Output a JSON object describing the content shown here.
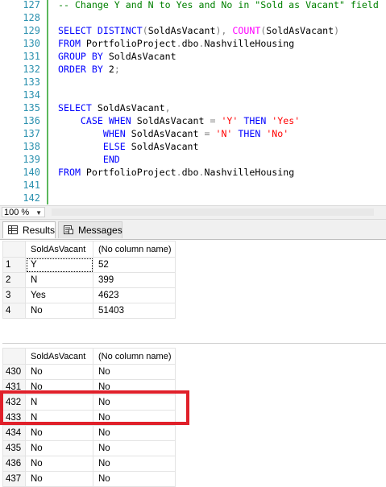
{
  "editor": {
    "lines": [
      {
        "num": "127",
        "segments": [
          {
            "cls": "cm",
            "text": "-- Change Y and N to Yes and No in \"Sold as Vacant\" field"
          }
        ]
      },
      {
        "num": "128",
        "segments": []
      },
      {
        "num": "129",
        "segments": [
          {
            "cls": "kw",
            "text": "SELECT DISTINCT"
          },
          {
            "cls": "op",
            "text": "("
          },
          {
            "cls": "",
            "text": "SoldAsVacant"
          },
          {
            "cls": "op",
            "text": "),"
          },
          {
            "cls": "",
            "text": " "
          },
          {
            "cls": "fn",
            "text": "COUNT"
          },
          {
            "cls": "op",
            "text": "("
          },
          {
            "cls": "",
            "text": "SoldAsVacant"
          },
          {
            "cls": "op",
            "text": ")"
          }
        ]
      },
      {
        "num": "130",
        "segments": [
          {
            "cls": "kw",
            "text": "FROM"
          },
          {
            "cls": "",
            "text": " PortfolioProject"
          },
          {
            "cls": "op",
            "text": "."
          },
          {
            "cls": "",
            "text": "dbo"
          },
          {
            "cls": "op",
            "text": "."
          },
          {
            "cls": "",
            "text": "NashvilleHousing"
          }
        ]
      },
      {
        "num": "131",
        "segments": [
          {
            "cls": "kw",
            "text": "GROUP BY"
          },
          {
            "cls": "",
            "text": " SoldAsVacant"
          }
        ]
      },
      {
        "num": "132",
        "segments": [
          {
            "cls": "kw",
            "text": "ORDER BY"
          },
          {
            "cls": "",
            "text": " 2"
          },
          {
            "cls": "op",
            "text": ";"
          }
        ]
      },
      {
        "num": "133",
        "segments": []
      },
      {
        "num": "134",
        "segments": []
      },
      {
        "num": "135",
        "segments": [
          {
            "cls": "kw",
            "text": "SELECT"
          },
          {
            "cls": "",
            "text": " SoldAsVacant"
          },
          {
            "cls": "op",
            "text": ","
          }
        ]
      },
      {
        "num": "136",
        "segments": [
          {
            "cls": "",
            "text": "    "
          },
          {
            "cls": "kw",
            "text": "CASE WHEN"
          },
          {
            "cls": "",
            "text": " SoldAsVacant "
          },
          {
            "cls": "op",
            "text": "="
          },
          {
            "cls": "",
            "text": " "
          },
          {
            "cls": "str",
            "text": "'Y'"
          },
          {
            "cls": "",
            "text": " "
          },
          {
            "cls": "kw",
            "text": "THEN"
          },
          {
            "cls": "",
            "text": " "
          },
          {
            "cls": "str",
            "text": "'Yes'"
          }
        ]
      },
      {
        "num": "137",
        "segments": [
          {
            "cls": "",
            "text": "        "
          },
          {
            "cls": "kw",
            "text": "WHEN"
          },
          {
            "cls": "",
            "text": " SoldAsVacant "
          },
          {
            "cls": "op",
            "text": "="
          },
          {
            "cls": "",
            "text": " "
          },
          {
            "cls": "str",
            "text": "'N'"
          },
          {
            "cls": "",
            "text": " "
          },
          {
            "cls": "kw",
            "text": "THEN"
          },
          {
            "cls": "",
            "text": " "
          },
          {
            "cls": "str",
            "text": "'No'"
          }
        ]
      },
      {
        "num": "138",
        "segments": [
          {
            "cls": "",
            "text": "        "
          },
          {
            "cls": "kw",
            "text": "ELSE"
          },
          {
            "cls": "",
            "text": " SoldAsVacant"
          }
        ]
      },
      {
        "num": "139",
        "segments": [
          {
            "cls": "",
            "text": "        "
          },
          {
            "cls": "kw",
            "text": "END"
          }
        ]
      },
      {
        "num": "140",
        "segments": [
          {
            "cls": "kw",
            "text": "FROM"
          },
          {
            "cls": "",
            "text": " PortfolioProject"
          },
          {
            "cls": "op",
            "text": "."
          },
          {
            "cls": "",
            "text": "dbo"
          },
          {
            "cls": "op",
            "text": "."
          },
          {
            "cls": "",
            "text": "NashvilleHousing"
          }
        ]
      },
      {
        "num": "141",
        "segments": []
      },
      {
        "num": "142",
        "segments": []
      }
    ]
  },
  "zoom": {
    "value": "100 %",
    "icon": "chevron-down-icon"
  },
  "tabs": {
    "results_label": "Results",
    "messages_label": "Messages",
    "results_icon": "grid-icon",
    "messages_icon": "messages-icon"
  },
  "grid1": {
    "headers": [
      "SoldAsVacant",
      "(No column name)"
    ],
    "rows": [
      [
        "1",
        "Y",
        "52"
      ],
      [
        "2",
        "N",
        "399"
      ],
      [
        "3",
        "Yes",
        "4623"
      ],
      [
        "4",
        "No",
        "51403"
      ]
    ]
  },
  "grid2": {
    "headers": [
      "SoldAsVacant",
      "(No column name)"
    ],
    "rows": [
      [
        "430",
        "No",
        "No"
      ],
      [
        "431",
        "No",
        "No"
      ],
      [
        "432",
        "N",
        "No"
      ],
      [
        "433",
        "N",
        "No"
      ],
      [
        "434",
        "No",
        "No"
      ],
      [
        "435",
        "No",
        "No"
      ],
      [
        "436",
        "No",
        "No"
      ],
      [
        "437",
        "No",
        "No"
      ]
    ]
  },
  "colors": {
    "highlight": "#e0202a",
    "keyword": "#0000ff",
    "function": "#ff00ff",
    "string": "#ff0000",
    "comment": "#008000",
    "line_number": "#2b91af"
  }
}
